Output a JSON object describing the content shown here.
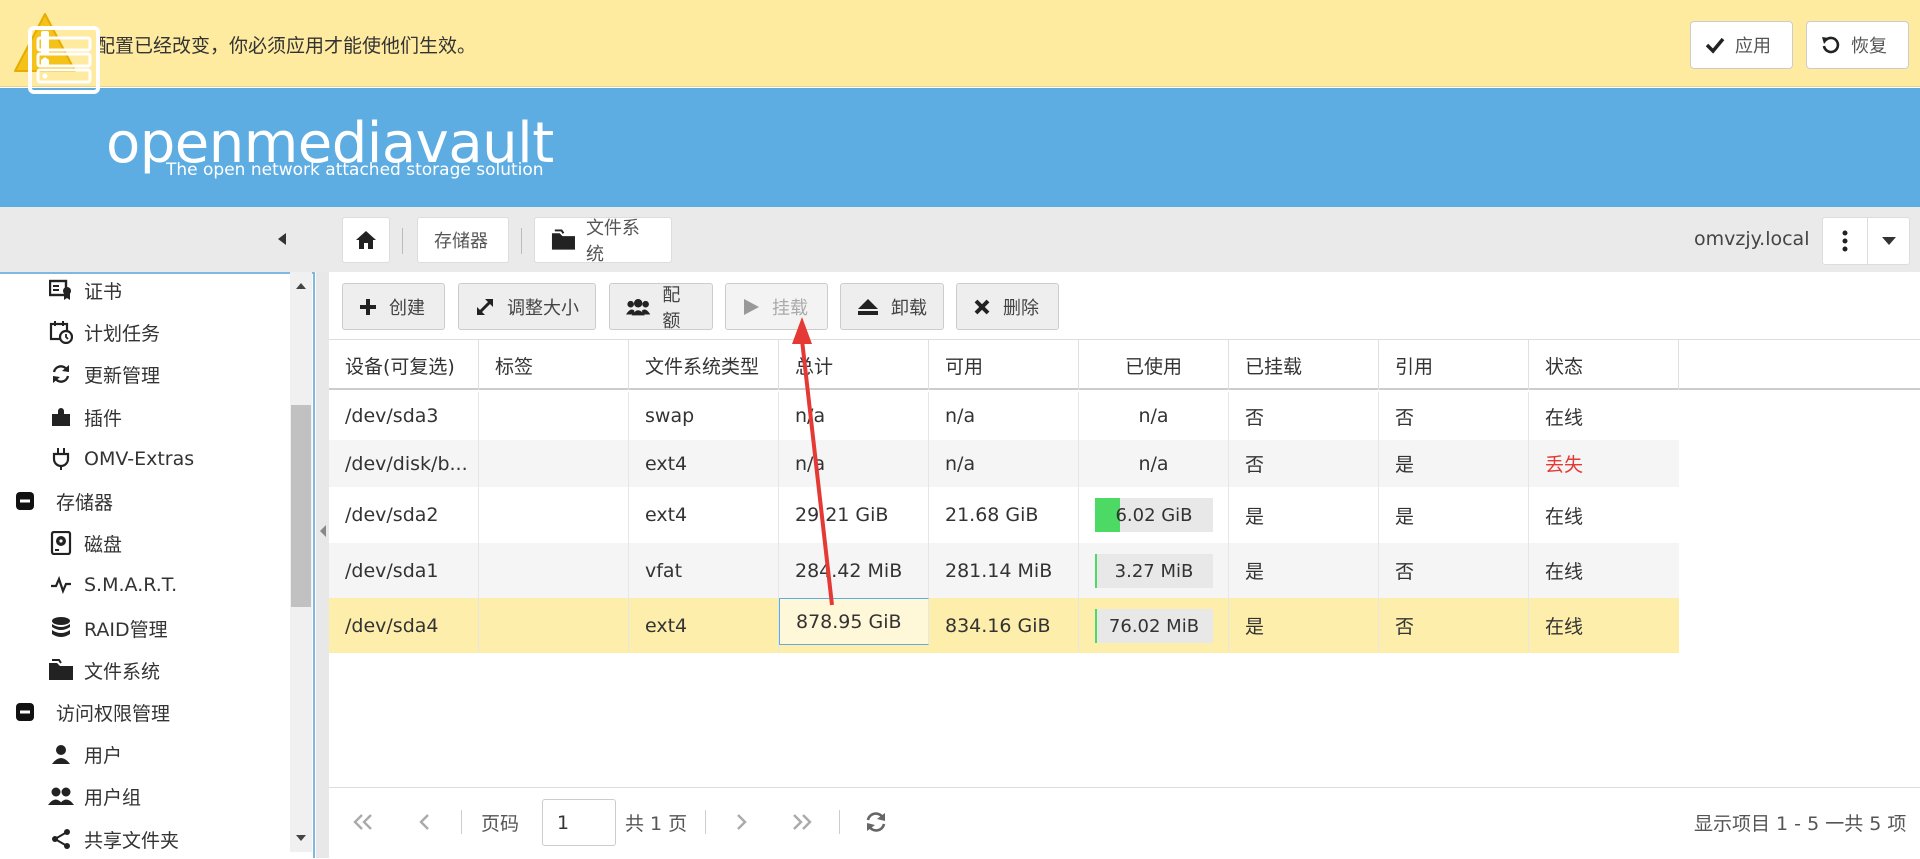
{
  "notice": {
    "message": "配置已经改变，你必须应用才能使他们生效。",
    "apply_label": "应用",
    "revert_label": "恢复"
  },
  "header": {
    "brand": "openmediavault",
    "tagline": "The open network attached storage solution"
  },
  "breadcrumb": {
    "storage": "存储器",
    "filesystems": "文件系统",
    "hostname": "omvzjy.local"
  },
  "sidebar": {
    "items": [
      {
        "label": "证书",
        "icon": "certificate-icon",
        "level": 2
      },
      {
        "label": "计划任务",
        "icon": "calendar-clock-icon",
        "level": 2
      },
      {
        "label": "更新管理",
        "icon": "refresh-icon",
        "level": 2
      },
      {
        "label": "插件",
        "icon": "puzzle-icon",
        "level": 2
      },
      {
        "label": "OMV-Extras",
        "icon": "plug-icon",
        "level": 2
      },
      {
        "label": "存储器",
        "icon": "minus-box-icon",
        "level": 1
      },
      {
        "label": "磁盘",
        "icon": "harddisk-icon",
        "level": 2
      },
      {
        "label": "S.M.A.R.T.",
        "icon": "pulse-icon",
        "level": 2
      },
      {
        "label": "RAID管理",
        "icon": "database-icon",
        "level": 2
      },
      {
        "label": "文件系统",
        "icon": "folder-icon",
        "level": 2
      },
      {
        "label": "访问权限管理",
        "icon": "minus-box-icon",
        "level": 1
      },
      {
        "label": "用户",
        "icon": "user-icon",
        "level": 2
      },
      {
        "label": "用户组",
        "icon": "users-icon",
        "level": 2
      },
      {
        "label": "共享文件夹",
        "icon": "share-icon",
        "level": 2
      }
    ]
  },
  "toolbar": {
    "create": "创建",
    "resize": "调整大小",
    "quota": "配额",
    "mount": "挂载",
    "unmount": "卸载",
    "delete": "删除"
  },
  "table": {
    "columns": [
      "设备(可复选)",
      "标签",
      "文件系统类型",
      "总计",
      "可用",
      "已使用",
      "已挂载",
      "引用",
      "状态"
    ],
    "rows": [
      {
        "device": "/dev/sda3",
        "label": "",
        "fstype": "swap",
        "total": "n/a",
        "available": "n/a",
        "used": "n/a",
        "used_pct": null,
        "mounted": "否",
        "referenced": "否",
        "status": "在线"
      },
      {
        "device": "/dev/disk/b...",
        "label": "",
        "fstype": "ext4",
        "total": "n/a",
        "available": "n/a",
        "used": "n/a",
        "used_pct": null,
        "mounted": "否",
        "referenced": "是",
        "status": "丢失"
      },
      {
        "device": "/dev/sda2",
        "label": "",
        "fstype": "ext4",
        "total": "29.21 GiB",
        "available": "21.68 GiB",
        "used": "6.02 GiB",
        "used_pct": 21,
        "mounted": "是",
        "referenced": "是",
        "status": "在线"
      },
      {
        "device": "/dev/sda1",
        "label": "",
        "fstype": "vfat",
        "total": "284.42 MiB",
        "available": "281.14 MiB",
        "used": "3.27 MiB",
        "used_pct": 1,
        "mounted": "是",
        "referenced": "否",
        "status": "在线"
      },
      {
        "device": "/dev/sda4",
        "label": "",
        "fstype": "ext4",
        "total": "878.95 GiB",
        "available": "834.16 GiB",
        "used": "76.02 MiB",
        "used_pct": 1,
        "mounted": "是",
        "referenced": "否",
        "status": "在线"
      }
    ]
  },
  "pager": {
    "page_label": "页码",
    "page_value": "1",
    "total_pages": "共 1 页",
    "summary": "显示项目 1 - 5 一共 5 项"
  },
  "colors": {
    "notice_bg": "#feeba0",
    "header_bg": "#5dade2",
    "selected_row": "#fdeeab",
    "lost_status": "#e53935",
    "usage_fill": "#4cd964",
    "arrow": "#e53935"
  }
}
